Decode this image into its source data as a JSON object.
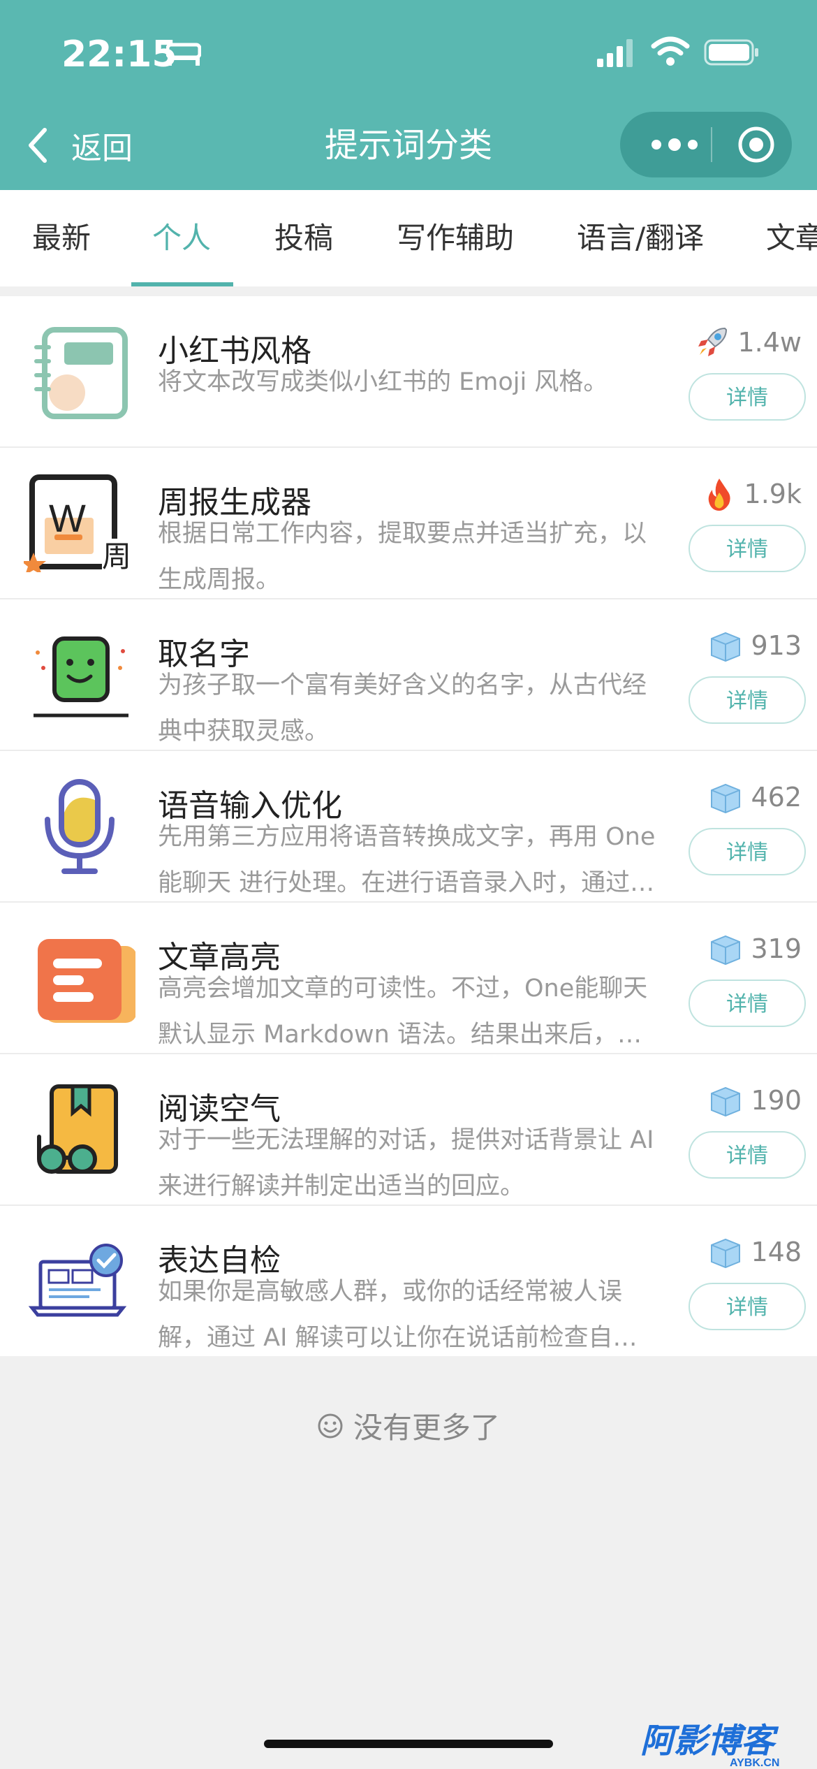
{
  "status_bar": {
    "time": "22:15"
  },
  "nav": {
    "back_label": "返回",
    "title": "提示词分类"
  },
  "tabs": [
    {
      "label": "最新",
      "active": false
    },
    {
      "label": "个人",
      "active": true
    },
    {
      "label": "投稿",
      "active": false
    },
    {
      "label": "写作辅助",
      "active": false
    },
    {
      "label": "语言/翻译",
      "active": false
    },
    {
      "label": "文章",
      "active": false
    }
  ],
  "items": [
    {
      "title": "小红书风格",
      "desc": "将文本改写成类似小红书的 Emoji 风格。",
      "stat_icon": "rocket-icon",
      "count": "1.4w",
      "button": "详情"
    },
    {
      "title": "周报生成器",
      "desc": "根据日常工作内容，提取要点并适当扩充，以生成周报。",
      "stat_icon": "fire-icon",
      "count": "1.9k",
      "button": "详情"
    },
    {
      "title": "取名字",
      "desc": "为孩子取一个富有美好含义的名字，从古代经典中获取灵感。",
      "stat_icon": "ice-cube-icon",
      "count": "913",
      "button": "详情"
    },
    {
      "title": "语音输入优化",
      "desc": "先用第三方应用将语音转换成文字，再用 One能聊天 进行处理。在进行语音录入时，通过…",
      "stat_icon": "ice-cube-icon",
      "count": "462",
      "button": "详情"
    },
    {
      "title": "文章高亮",
      "desc": "高亮会增加文章的可读性。不过，One能聊天默认显示 Markdown 语法。结果出来后，…",
      "stat_icon": "ice-cube-icon",
      "count": "319",
      "button": "详情"
    },
    {
      "title": "阅读空气",
      "desc": "对于一些无法理解的对话，提供对话背景让 AI 来进行解读并制定出适当的回应。",
      "stat_icon": "ice-cube-icon",
      "count": "190",
      "button": "详情"
    },
    {
      "title": "表达自检",
      "desc": "如果你是高敏感人群，或你的话经常被人误解，通过 AI 解读可以让你在说话前检查自…",
      "stat_icon": "ice-cube-icon",
      "count": "148",
      "button": "详情"
    }
  ],
  "footer": {
    "no_more": "没有更多了"
  },
  "watermark": {
    "text": "阿影博客",
    "subtext": "AYBK.CN"
  },
  "colors": {
    "accent": "#52b3ac",
    "header": "#5ab8b1"
  }
}
